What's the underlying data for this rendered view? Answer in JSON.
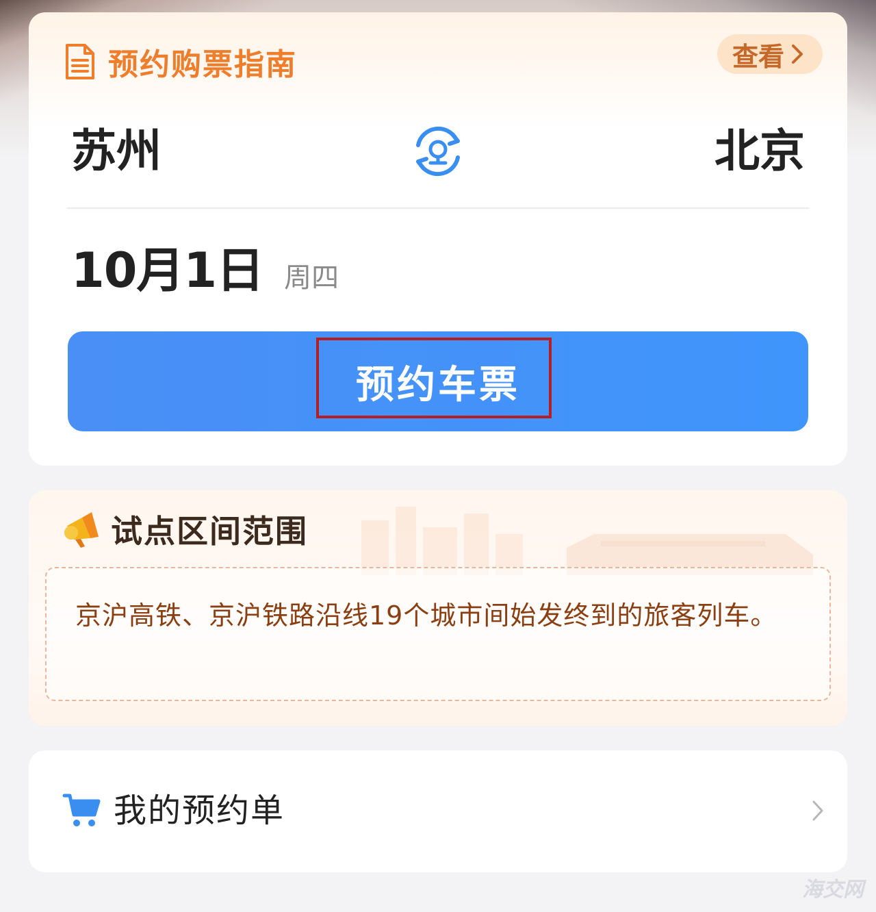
{
  "guide": {
    "label": "预约购票指南",
    "view_label": "查看",
    "icon": "document-icon",
    "color": "#ee7d2c"
  },
  "route": {
    "from": "苏州",
    "to": "北京",
    "swap_icon": "railway-swap-icon"
  },
  "date": {
    "main": "10月1日",
    "weekday": "周四"
  },
  "reserve_button": {
    "label": "预约车票",
    "color": "#3f95fb",
    "highlight_color": "#b51e22"
  },
  "pilot": {
    "title": "试点区间范围",
    "icon": "megaphone-icon",
    "text": "京沪高铁、京沪铁路沿线19个城市间始发终到的旅客列车。"
  },
  "orders": {
    "label": "我的预约单",
    "icon": "cart-icon"
  },
  "watermark": {
    "text": "海交网"
  }
}
